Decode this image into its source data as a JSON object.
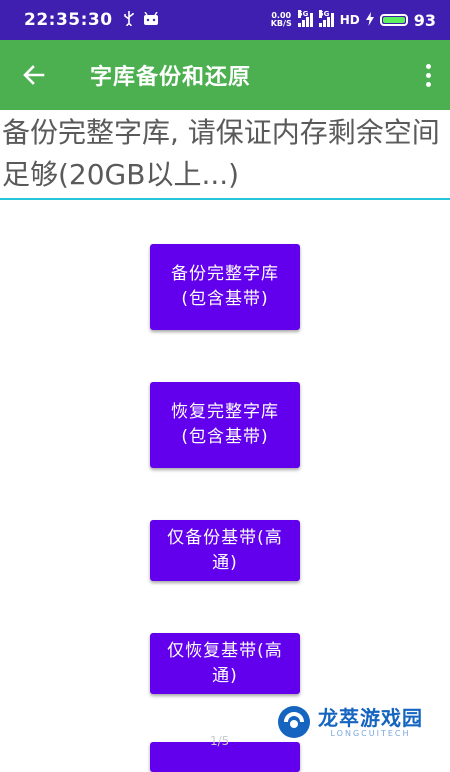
{
  "status_bar": {
    "time": "22:35:30",
    "net_speed_value": "0.00",
    "net_speed_unit": "KB/S",
    "sim1_network": "5G",
    "sim2_network": "5G",
    "hd_label": "HD",
    "battery_level": "93"
  },
  "app_bar": {
    "title": "字库备份和还原"
  },
  "notice": {
    "text": "备份完整字库, 请保证内存剩余空间足够(20GB以上...)"
  },
  "buttons": {
    "backup_full": "备份完整字库(包含基带)",
    "restore_full": "恢复完整字库(包含基带)",
    "backup_baseband": "仅备份基带(高通)",
    "restore_baseband": "仅恢复基带(高通)"
  },
  "page_indicator": "1/5",
  "watermark": {
    "name": "龙萃游戏园",
    "sub": "LONGCUITECH"
  },
  "colors": {
    "status_bar": "#3f1fb0",
    "app_bar": "#4caf50",
    "button": "#6200ee",
    "divider": "#26c6da"
  }
}
